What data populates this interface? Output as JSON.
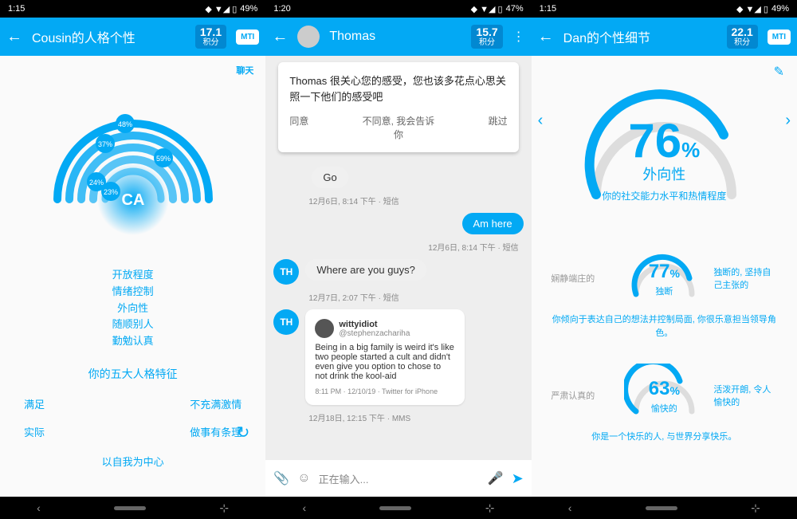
{
  "status": {
    "time_left": "1:15",
    "time_mid": "1:20",
    "time_right": "1:15",
    "batt_left": "49%",
    "batt_mid": "47%",
    "batt_right": "49%"
  },
  "s1": {
    "title": "Cousin的人格个性",
    "score": "17.1",
    "score_lbl": "积分",
    "mti": "MTI",
    "edit": "聊天",
    "arcs": [
      "48%",
      "37%",
      "59%",
      "24%",
      "23%"
    ],
    "center": "CA",
    "labels": [
      "开放程度",
      "情绪控制",
      "外向性",
      "随顺别人",
      "勤勉认真"
    ],
    "traits_title": "你的五大人格特征",
    "traits": {
      "a": "满足",
      "b": "不充满激情",
      "c": "实际",
      "d": "做事有条理",
      "e": "以自我为中心"
    }
  },
  "s2": {
    "title": "Thomas",
    "score": "15.7",
    "score_lbl": "积分",
    "suggestion": "Thomas 很关心您的感受，您也该多花点心思关照一下他们的感受吧",
    "btns": {
      "a": "同意",
      "b": "不同意, 我会告诉你",
      "c": "跳过"
    },
    "m1": "Go",
    "t1": "12月6日, 8:14 下午 · 短信",
    "m2": "Am here",
    "t2": "12月6日, 8:14 下午 · 短信",
    "m3": "Where are you guys?",
    "t3": "12月7日, 2:07 下午 · 短信",
    "th": "TH",
    "tweet": {
      "name": "wittyidiot",
      "handle": "@stephenzachariha",
      "body": "Being in a big family is weird it's like two people started a cult and didn't even give you option to chose to not drink the kool-aid",
      "meta": "8:11 PM · 12/10/19 · Twitter for iPhone"
    },
    "t4": "12月18日, 12:15 下午 · MMS",
    "placeholder": "正在输入..."
  },
  "s3": {
    "title": "Dan的个性细节",
    "score": "22.1",
    "score_lbl": "积分",
    "mti": "MTI",
    "main": {
      "pct": "76",
      "label": "外向性",
      "desc": "你的社交能力水平和热情程度"
    },
    "g1": {
      "left": "娴静端庄的",
      "pct": "77",
      "label": "独断",
      "right": "独断的, 坚持自己主张的",
      "desc": "你倾向于表达自己的想法并控制局面, 你很乐意担当领导角色。"
    },
    "g2": {
      "left": "严肃认真的",
      "pct": "63",
      "label": "愉快的",
      "right": "活泼开朗, 令人愉快的",
      "desc": "你是一个快乐的人, 与世界分享快乐。"
    }
  }
}
